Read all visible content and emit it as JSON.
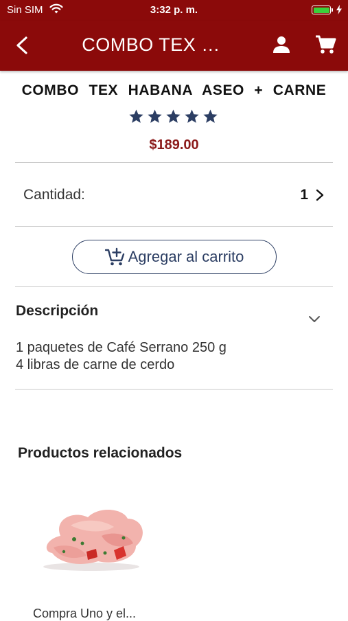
{
  "status_bar": {
    "carrier": "Sin SIM",
    "time": "3:32 p. m.",
    "battery_level": 1.0,
    "battery_color": "#3ad13a"
  },
  "nav": {
    "title": "COMBO TEX  …",
    "background_color": "#8b0a0a",
    "icons": [
      "back-chevron-icon",
      "person-icon",
      "cart-icon"
    ]
  },
  "product": {
    "name": "COMBO TEX HABANA ASEO + CARNE",
    "rating": 5,
    "rating_max": 5,
    "price": "$189.00",
    "price_color": "#8b1a1a",
    "star_color": "#2c3e63"
  },
  "quantity": {
    "label": "Cantidad:",
    "value": "1"
  },
  "add_to_cart": {
    "label": "Agregar al carrito",
    "accent_color": "#2c3e63"
  },
  "description": {
    "title": "Descripción",
    "lines": [
      "1 paquetes de Café Serrano 250 g",
      "4 libras de carne de cerdo"
    ]
  },
  "related": {
    "title": "Productos relacionados",
    "items": [
      {
        "name": "Compra Uno y el..."
      }
    ]
  }
}
